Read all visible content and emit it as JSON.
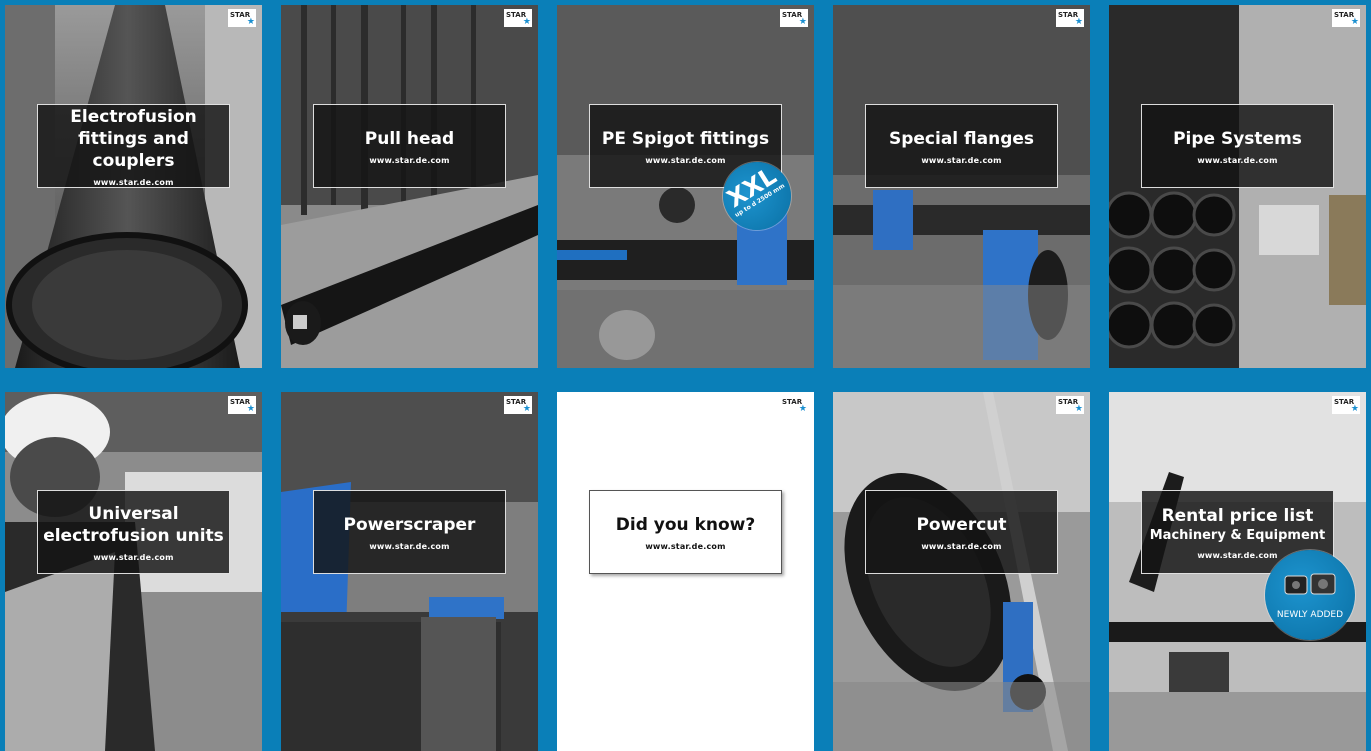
{
  "cards": [
    {
      "title": "Electrofusion fittings and couplers",
      "url": "www.star.de.com"
    },
    {
      "title": "Pull head",
      "url": "www.star.de.com"
    },
    {
      "title": "PE Spigot fittings",
      "url": "www.star.de.com",
      "badge": {
        "big": "XXL",
        "small": "up to d 2500 mm"
      }
    },
    {
      "title": "Special flanges",
      "url": "www.star.de.com"
    },
    {
      "title": "Pipe Systems",
      "url": "www.star.de.com"
    },
    {
      "title": "Universal electrofusion units",
      "url": "www.star.de.com"
    },
    {
      "title": "Powerscraper",
      "url": "www.star.de.com"
    },
    {
      "title": "Did you know?",
      "url": "www.star.de.com"
    },
    {
      "title": "Powercut",
      "url": "www.star.de.com"
    },
    {
      "title": "Rental price list",
      "subtitle": "Machinery & Equipment",
      "url": "www.star.de.com",
      "badge": {
        "text": "NEWLY ADDED"
      }
    }
  ],
  "logo": {
    "text": "STAR",
    "icon": "star-icon"
  },
  "colors": {
    "page_bg": "#0a7fb8",
    "accent": "#1a8fd0",
    "label_bg": "#141414"
  }
}
